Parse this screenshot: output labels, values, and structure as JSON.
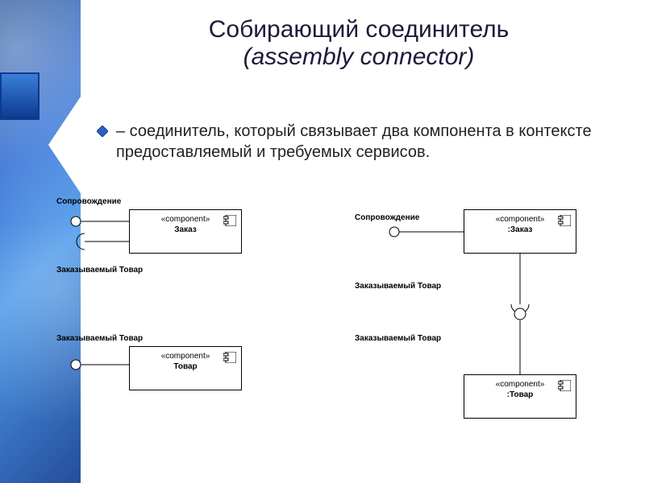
{
  "title": {
    "line1": "Собирающий соединитель",
    "line2": "(assembly connector)"
  },
  "bullet": "– соединитель, который связывает два компонента в контексте предоставляемый и требуемых сервисов.",
  "stereotype": "«component»",
  "components": {
    "left_top": "Заказ",
    "left_bottom": "Товар",
    "right_top": ":Заказ",
    "right_bottom": ":Товар"
  },
  "labels": {
    "escort": "Сопровождение",
    "ordered_good": "Заказываемый Товар"
  }
}
